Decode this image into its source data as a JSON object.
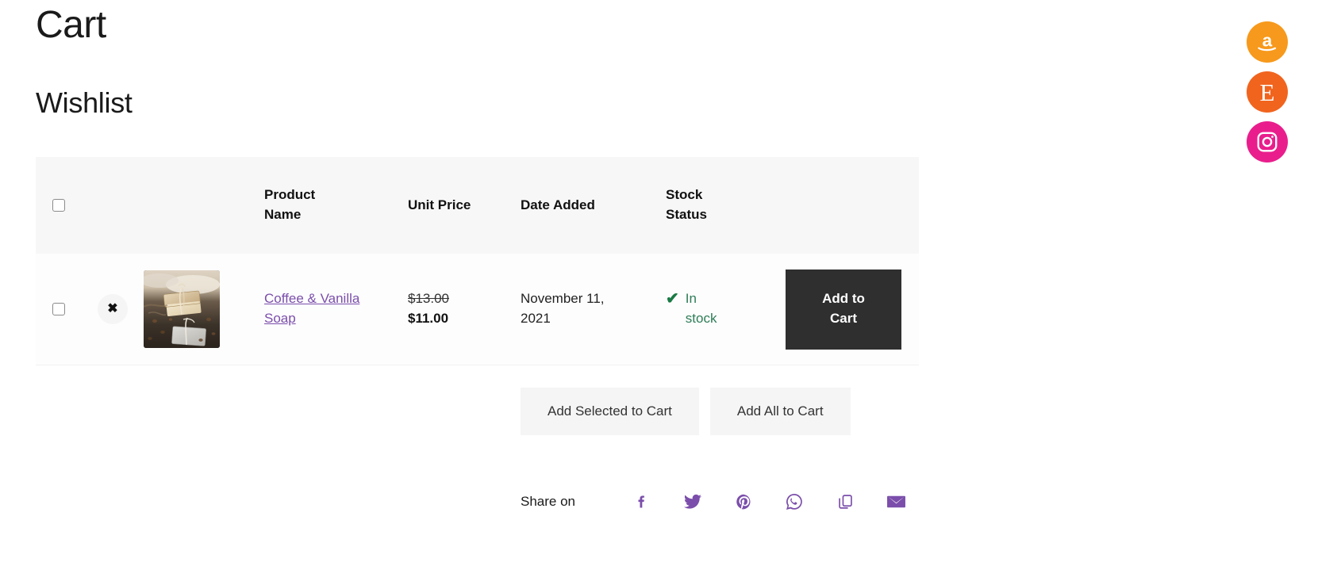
{
  "page": {
    "title": "Cart",
    "section_title": "Wishlist"
  },
  "table": {
    "headers": {
      "select_all": "",
      "remove": "",
      "thumbnail": "",
      "product_name": "Product Name",
      "unit_price": "Unit Price",
      "date_added": "Date Added",
      "stock_status": "Stock Status",
      "action": ""
    },
    "rows": [
      {
        "selected": false,
        "remove_label": "✖",
        "product_name": "Coffee & Vanilla Soap",
        "price_old": "$13.00",
        "price_new": "$11.00",
        "date_added": "November 11, 2021",
        "stock_status": "In stock",
        "stock_icon": "check-icon",
        "action_label": "Add to Cart"
      }
    ]
  },
  "bulk_actions": {
    "add_selected": "Add Selected to Cart",
    "add_all": "Add All to Cart"
  },
  "share": {
    "label": "Share on",
    "items": [
      {
        "name": "facebook-icon",
        "title": "Facebook"
      },
      {
        "name": "twitter-icon",
        "title": "Twitter"
      },
      {
        "name": "pinterest-icon",
        "title": "Pinterest"
      },
      {
        "name": "whatsapp-icon",
        "title": "WhatsApp"
      },
      {
        "name": "copy-link-icon",
        "title": "Copy Link"
      },
      {
        "name": "email-icon",
        "title": "Email"
      }
    ]
  },
  "floating_social": {
    "items": [
      {
        "name": "amazon-icon",
        "title": "Amazon",
        "color": "#f7991c"
      },
      {
        "name": "etsy-icon",
        "title": "Etsy",
        "color": "#f1641e",
        "glyph": "E"
      },
      {
        "name": "instagram-icon",
        "title": "Instagram",
        "color": "#e91e8c"
      }
    ]
  },
  "colors": {
    "link_purple": "#7b4eab",
    "in_stock_green": "#2e7d57",
    "button_dark": "#2f2f2f",
    "header_bg": "#f7f7f7",
    "bulk_btn_bg": "#f5f5f5"
  }
}
